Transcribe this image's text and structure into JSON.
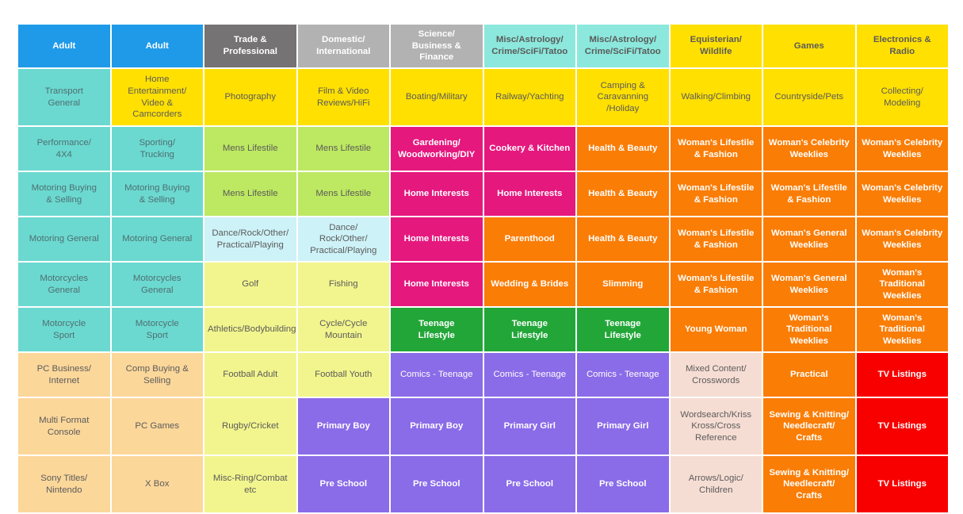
{
  "grid": {
    "columns": 10,
    "rows": 10,
    "palette": {
      "blue": "#1f9ae8",
      "dark_grey": "#757373",
      "grey": "#b2b2b2",
      "aqua": "#8ce8dc",
      "yellow": "#ffe000",
      "teal": "#6bd9d0",
      "light_green": "#bde861",
      "pink": "#e5187e",
      "orange": "#fa7d06",
      "pale_cyan": "#cdf2f7",
      "pale_yellow": "#f2f58d",
      "green": "#22a638",
      "peach": "#fcd79a",
      "purple": "#8a6be8",
      "pale_pink": "#f6ddd3",
      "red": "#f90000"
    },
    "header": [
      {
        "label": "Adult",
        "color": "blue"
      },
      {
        "label": "Adult",
        "color": "blue"
      },
      {
        "label": "Trade & Professional",
        "color": "dark_grey"
      },
      {
        "label": "Domestic/\nInternational",
        "color": "grey"
      },
      {
        "label": "Science/\nBusiness &\nFinance",
        "color": "grey"
      },
      {
        "label": "Misc/Astrology/\nCrime/SciFi/Tatoo",
        "color": "aqua"
      },
      {
        "label": "Misc/Astrology/\nCrime/SciFi/Tatoo",
        "color": "aqua"
      },
      {
        "label": "Equisterian/\nWildlife",
        "color": "yellow"
      },
      {
        "label": "Games",
        "color": "yellow"
      },
      {
        "label": "Electronics &\nRadio",
        "color": "yellow"
      }
    ],
    "rows_data": [
      {
        "tall": true,
        "cells": [
          {
            "label": "Transport\nGeneral",
            "color": "teal"
          },
          {
            "label": "Home\nEntertainment/\nVideo &\nCamcorders",
            "color": "yellow"
          },
          {
            "label": "Photography",
            "color": "yellow"
          },
          {
            "label": "Film & Video\nReviews/HiFi",
            "color": "yellow"
          },
          {
            "label": "Boating/Military",
            "color": "yellow"
          },
          {
            "label": "Railway/Yachting",
            "color": "yellow"
          },
          {
            "label": "Camping &\nCaravanning\n/Holiday",
            "color": "yellow"
          },
          {
            "label": "Walking/Climbing",
            "color": "yellow"
          },
          {
            "label": "Countryside/Pets",
            "color": "yellow"
          },
          {
            "label": "Collecting/\nModeling",
            "color": "yellow"
          }
        ]
      },
      {
        "cells": [
          {
            "label": "Performance/\n4X4",
            "color": "teal"
          },
          {
            "label": "Sporting/\nTrucking",
            "color": "teal"
          },
          {
            "label": "Mens Lifestile",
            "color": "light_green"
          },
          {
            "label": "Mens Lifestile",
            "color": "light_green"
          },
          {
            "label": "Gardening/\nWoodworking/DIY",
            "color": "pink",
            "bold": true
          },
          {
            "label": "Cookery & Kitchen",
            "color": "pink",
            "bold": true
          },
          {
            "label": "Health & Beauty",
            "color": "orange",
            "bold": true
          },
          {
            "label": "Woman's Lifestile\n& Fashion",
            "color": "orange",
            "bold": true
          },
          {
            "label": "Woman's Celebrity\nWeeklies",
            "color": "orange",
            "bold": true
          },
          {
            "label": "Woman's Celebrity\nWeeklies",
            "color": "orange",
            "bold": true
          }
        ]
      },
      {
        "cells": [
          {
            "label": "Motoring Buying\n& Selling",
            "color": "teal"
          },
          {
            "label": "Motoring Buying\n& Selling",
            "color": "teal"
          },
          {
            "label": "Mens Lifestile",
            "color": "light_green"
          },
          {
            "label": "Mens Lifestile",
            "color": "light_green"
          },
          {
            "label": "Home Interests",
            "color": "pink",
            "bold": true
          },
          {
            "label": "Home Interests",
            "color": "pink",
            "bold": true
          },
          {
            "label": "Health & Beauty",
            "color": "orange",
            "bold": true
          },
          {
            "label": "Woman's Lifestile\n& Fashion",
            "color": "orange",
            "bold": true
          },
          {
            "label": "Woman's Lifestile\n& Fashion",
            "color": "orange",
            "bold": true
          },
          {
            "label": "Woman's Celebrity\nWeeklies",
            "color": "orange",
            "bold": true
          }
        ]
      },
      {
        "cells": [
          {
            "label": "Motoring General",
            "color": "teal"
          },
          {
            "label": "Motoring General",
            "color": "teal"
          },
          {
            "label": "Dance/Rock/Other/\nPractical/Playing",
            "color": "pale_cyan"
          },
          {
            "label": "Dance/\nRock/Other/\nPractical/Playing",
            "color": "pale_cyan"
          },
          {
            "label": "Home Interests",
            "color": "pink",
            "bold": true
          },
          {
            "label": "Parenthood",
            "color": "orange",
            "bold": true
          },
          {
            "label": "Health & Beauty",
            "color": "orange",
            "bold": true
          },
          {
            "label": "Woman's Lifestile\n& Fashion",
            "color": "orange",
            "bold": true
          },
          {
            "label": "Woman's General\nWeeklies",
            "color": "orange",
            "bold": true
          },
          {
            "label": "Woman's Celebrity\nWeeklies",
            "color": "orange",
            "bold": true
          }
        ]
      },
      {
        "cells": [
          {
            "label": "Motorcycles\nGeneral",
            "color": "teal"
          },
          {
            "label": "Motorcycles\nGeneral",
            "color": "teal"
          },
          {
            "label": "Golf",
            "color": "pale_yellow"
          },
          {
            "label": "Fishing",
            "color": "pale_yellow"
          },
          {
            "label": "Home Interests",
            "color": "pink",
            "bold": true
          },
          {
            "label": "Wedding & Brides",
            "color": "orange",
            "bold": true
          },
          {
            "label": "Slimming",
            "color": "orange",
            "bold": true
          },
          {
            "label": "Woman's Lifestile\n& Fashion",
            "color": "orange",
            "bold": true
          },
          {
            "label": "Woman's General\nWeeklies",
            "color": "orange",
            "bold": true
          },
          {
            "label": "Woman's\nTraditional\nWeeklies",
            "color": "orange",
            "bold": true
          }
        ]
      },
      {
        "cells": [
          {
            "label": "Motorcycle\nSport",
            "color": "teal"
          },
          {
            "label": "Motorcycle\nSport",
            "color": "teal"
          },
          {
            "label": "Athletics/Bodybuilding",
            "color": "pale_yellow"
          },
          {
            "label": "Cycle/Cycle\nMountain",
            "color": "pale_yellow"
          },
          {
            "label": "Teenage\nLifestyle",
            "color": "green",
            "bold": true
          },
          {
            "label": "Teenage\nLifestyle",
            "color": "green",
            "bold": true
          },
          {
            "label": "Teenage\nLifestyle",
            "color": "green",
            "bold": true
          },
          {
            "label": "Young Woman",
            "color": "orange",
            "bold": true
          },
          {
            "label": "Woman's\nTraditional\nWeeklies",
            "color": "orange",
            "bold": true
          },
          {
            "label": "Woman's\nTraditional\nWeeklies",
            "color": "orange",
            "bold": true
          }
        ]
      },
      {
        "cells": [
          {
            "label": "PC Business/\nInternet",
            "color": "peach"
          },
          {
            "label": "Comp Buying &\nSelling",
            "color": "peach"
          },
          {
            "label": "Football Adult",
            "color": "pale_yellow"
          },
          {
            "label": "Football Youth",
            "color": "pale_yellow"
          },
          {
            "label": "Comics - Teenage",
            "color": "purple"
          },
          {
            "label": "Comics - Teenage",
            "color": "purple"
          },
          {
            "label": "Comics - Teenage",
            "color": "purple"
          },
          {
            "label": "Mixed Content/\nCrosswords",
            "color": "pale_pink"
          },
          {
            "label": "Practical",
            "color": "orange",
            "bold": true
          },
          {
            "label": "TV Listings",
            "color": "red",
            "bold": true
          }
        ]
      },
      {
        "tall": true,
        "cells": [
          {
            "label": "Multi Format\nConsole",
            "color": "peach"
          },
          {
            "label": "PC Games",
            "color": "peach"
          },
          {
            "label": "Rugby/Cricket",
            "color": "pale_yellow"
          },
          {
            "label": "Primary Boy",
            "color": "purple",
            "bold": true
          },
          {
            "label": "Primary Boy",
            "color": "purple",
            "bold": true
          },
          {
            "label": "Primary Girl",
            "color": "purple",
            "bold": true
          },
          {
            "label": "Primary Girl",
            "color": "purple",
            "bold": true
          },
          {
            "label": "Wordsearch/Kriss\nKross/Cross\nReference",
            "color": "pale_pink"
          },
          {
            "label": "Sewing & Knitting/\nNeedlecraft/\nCrafts",
            "color": "orange",
            "bold": true
          },
          {
            "label": "TV Listings",
            "color": "red",
            "bold": true
          }
        ]
      },
      {
        "tall": true,
        "cells": [
          {
            "label": "Sony Titles/\nNintendo",
            "color": "peach"
          },
          {
            "label": "X Box",
            "color": "peach"
          },
          {
            "label": "Misc-Ring/Combat etc",
            "color": "pale_yellow"
          },
          {
            "label": "Pre School",
            "color": "purple",
            "bold": true
          },
          {
            "label": "Pre School",
            "color": "purple",
            "bold": true
          },
          {
            "label": "Pre School",
            "color": "purple",
            "bold": true
          },
          {
            "label": "Pre School",
            "color": "purple",
            "bold": true
          },
          {
            "label": "Arrows/Logic/\nChildren",
            "color": "pale_pink"
          },
          {
            "label": "Sewing & Knitting/\nNeedlecraft/\nCrafts",
            "color": "orange",
            "bold": true
          },
          {
            "label": "TV Listings",
            "color": "red",
            "bold": true
          }
        ]
      }
    ]
  }
}
